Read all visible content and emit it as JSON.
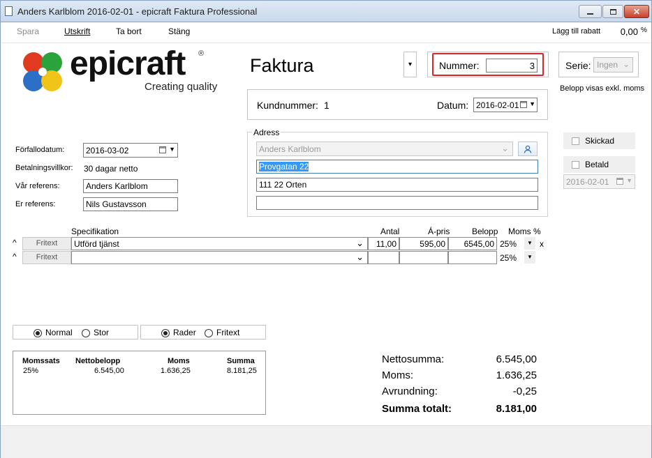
{
  "window": {
    "title": "Anders Karlblom 2016-02-01 - epicraft Faktura Professional"
  },
  "menu": {
    "spara": "Spara",
    "utskrift": "Utskrift",
    "ta_bort": "Ta bort",
    "stang": "Stäng"
  },
  "rabatt": {
    "label": "Lägg till rabatt",
    "value": "0,00",
    "unit": "%"
  },
  "logo": {
    "name": "epicraft",
    "reg": "®",
    "tagline": "Creating quality"
  },
  "doc": {
    "type_label": "Faktura",
    "dropdown_arrow": "▾"
  },
  "nummer": {
    "label": "Nummer:",
    "value": "3"
  },
  "serie": {
    "label": "Serie:",
    "value": "Ingen"
  },
  "belopp_note": "Belopp visas exkl. moms",
  "kund": {
    "label": "Kundnummer:",
    "value": "1",
    "datum_label": "Datum:",
    "datum_value": "2016-02-01"
  },
  "adress": {
    "legend": "Adress",
    "name": "Anders Karlblom",
    "line1": "Provgatan 22",
    "line2": "111 22 Orten",
    "line3": ""
  },
  "fields": {
    "forfallo_label": "Förfallodatum:",
    "forfallo_value": "2016-03-02",
    "betal_label": "Betalningsvillkor:",
    "betal_value": "30 dagar netto",
    "var_ref_label": "Vår referens:",
    "var_ref_value": "Anders Karlblom",
    "er_ref_label": "Er referens:",
    "er_ref_value": "Nils Gustavsson"
  },
  "status": {
    "skickad": "Skickad",
    "betald": "Betald",
    "betald_date": "2016-02-01"
  },
  "table": {
    "headers": {
      "spec": "Specifikation",
      "antal": "Antal",
      "apris": "Á-pris",
      "belopp": "Belopp",
      "moms": "Moms %"
    },
    "rows": [
      {
        "caret": "^",
        "type": "Fritext",
        "spec": "Utförd tjänst",
        "antal": "11,00",
        "apris": "595,00",
        "belopp": "6545,00",
        "moms": "25%",
        "delete": "x"
      },
      {
        "caret": "^",
        "type": "Fritext",
        "spec": "",
        "antal": "",
        "apris": "",
        "belopp": "",
        "moms": "25%",
        "delete": ""
      }
    ]
  },
  "view_options": {
    "normal": "Normal",
    "stor": "Stor",
    "rader": "Rader",
    "fritext": "Fritext"
  },
  "vat_table": {
    "headers": {
      "momssats": "Momssats",
      "netto": "Nettobelopp",
      "moms": "Moms",
      "summa": "Summa"
    },
    "row": {
      "momssats": "25%",
      "netto": "6.545,00",
      "moms": "1.636,25",
      "summa": "8.181,25"
    }
  },
  "totals": {
    "netto_label": "Nettosumma:",
    "netto_value": "6.545,00",
    "moms_label": "Moms:",
    "moms_value": "1.636,25",
    "avrund_label": "Avrundning:",
    "avrund_value": "-0,25",
    "total_label": "Summa totalt:",
    "total_value": "8.181,00"
  },
  "colors": {
    "highlight_red": "#d9242c",
    "selection_blue": "#3399ff"
  }
}
